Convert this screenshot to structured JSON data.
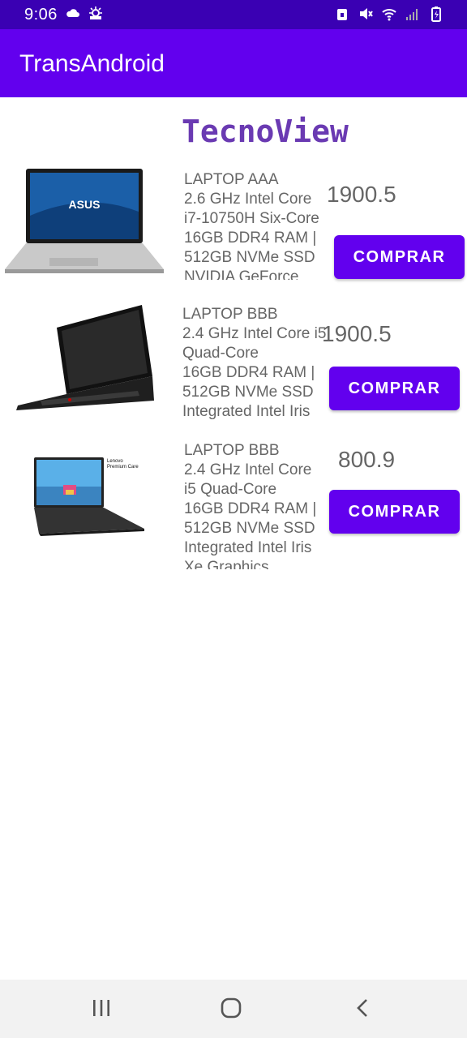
{
  "status_bar": {
    "time": "9:06"
  },
  "app_bar": {
    "title": "TransAndroid"
  },
  "brand": {
    "title": "TecnoView"
  },
  "products": [
    {
      "description": "LAPTOP AAA\n2.6 GHz Intel Core\ni7-10750H Six-Core\n16GB DDR4 RAM |\n512GB NVMe SSD\nNVIDIA GeForce",
      "price": "1900.5",
      "buy_label": "COMPRAR"
    },
    {
      "description": "LAPTOP BBB\n2.4 GHz Intel Core i5\nQuad-Core\n16GB DDR4 RAM |\n512GB NVMe SSD\nIntegrated Intel Iris",
      "price": "1900.5",
      "buy_label": "COMPRAR"
    },
    {
      "description": "LAPTOP BBB\n2.4 GHz Intel Core\ni5 Quad-Core\n16GB DDR4 RAM |\n512GB NVMe SSD\nIntegrated Intel Iris\nXe Graphics",
      "price": "800.9",
      "buy_label": "COMPRAR",
      "image_caption": "Lenovo\nPremium Care"
    }
  ],
  "colors": {
    "status_bar": "#3a00b3",
    "primary": "#6200ee",
    "brand_text": "#6a3ab2"
  }
}
